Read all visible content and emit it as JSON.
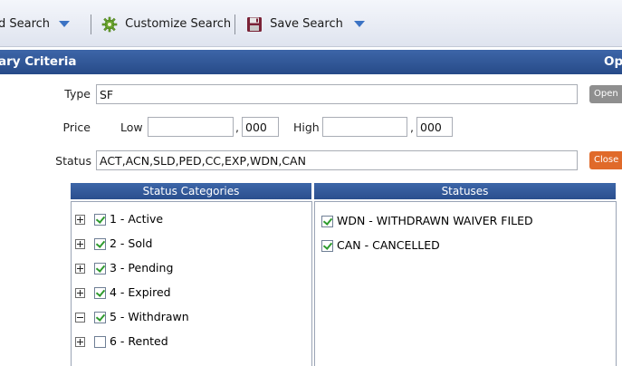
{
  "toolbar": {
    "search_label": "d Search",
    "customize_label": "Customize Search",
    "save_label": "Save Search"
  },
  "section": {
    "left_title": "ary Criteria",
    "right_title": "Op"
  },
  "form": {
    "type_label": "Type",
    "type_value": "SF",
    "price_label": "Price",
    "low_label": "Low",
    "low_value": "",
    "low_suffix_sep": ",",
    "low_suffix": "000",
    "high_label": "High",
    "high_value": "",
    "high_suffix_sep": ",",
    "high_suffix": "000",
    "status_label": "Status",
    "status_value": "ACT,ACN,SLD,PED,CC,EXP,WDN,CAN",
    "open_button": "Open",
    "close_button": "Close"
  },
  "status_categories": {
    "header": "Status Categories",
    "items": [
      {
        "label": "1 - Active",
        "expanded": false,
        "checked": true
      },
      {
        "label": "2 - Sold",
        "expanded": false,
        "checked": true
      },
      {
        "label": "3 - Pending",
        "expanded": false,
        "checked": true
      },
      {
        "label": "4 - Expired",
        "expanded": false,
        "checked": true
      },
      {
        "label": "5 - Withdrawn",
        "expanded": true,
        "checked": true
      },
      {
        "label": "6 - Rented",
        "expanded": false,
        "checked": false
      }
    ]
  },
  "statuses": {
    "header": "Statuses",
    "items": [
      {
        "label": "WDN - WITHDRAWN WAIVER FILED",
        "checked": true
      },
      {
        "label": "CAN - CANCELLED",
        "checked": true
      }
    ]
  },
  "colors": {
    "header_blue": "#2f5896",
    "close_orange": "#e06a2a",
    "check_green": "#2e9b2e",
    "dropdown_arrow": "#3b73c4"
  },
  "icons": {
    "customize": "gear-icon",
    "save": "floppy-disk-icon",
    "dropdown": "chevron-down-icon",
    "expand": "plus-box-icon",
    "collapse": "minus-box-icon"
  }
}
